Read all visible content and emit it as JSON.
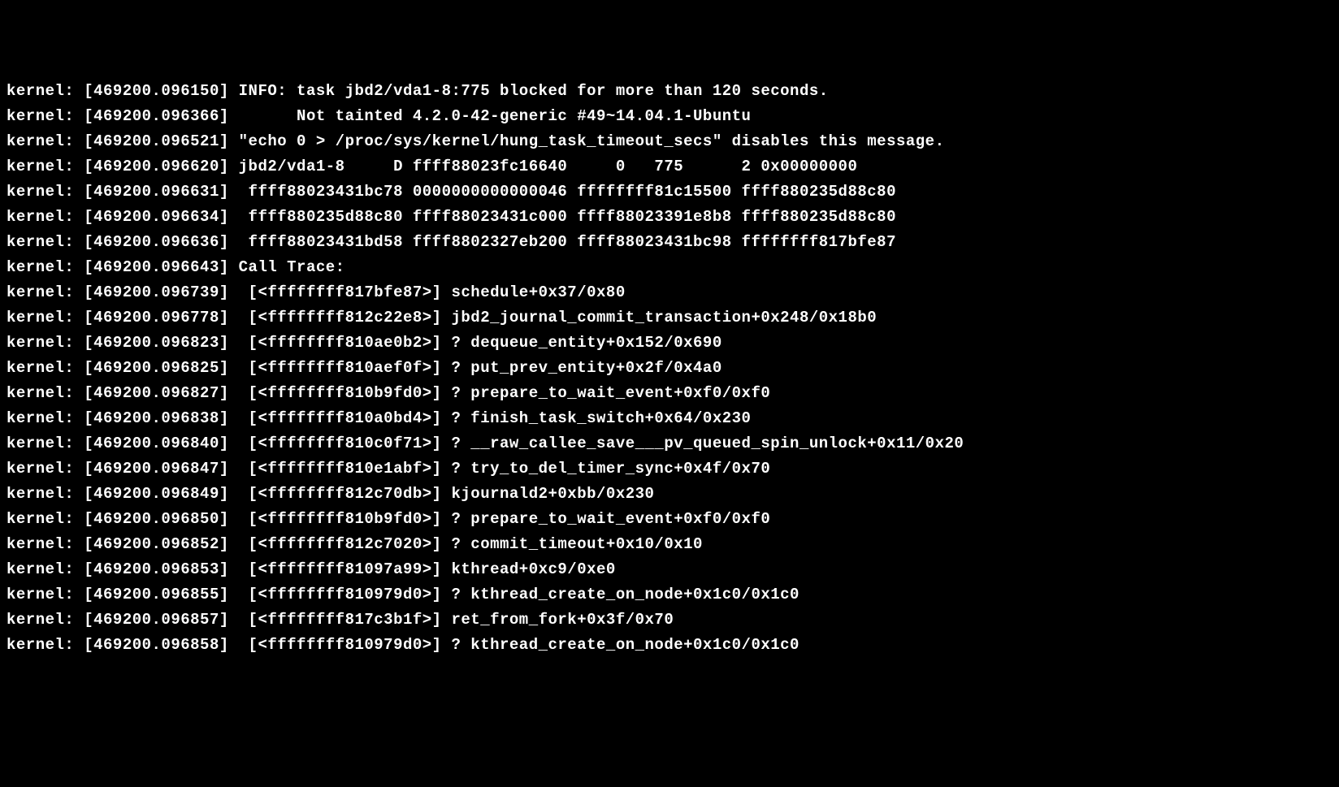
{
  "lines": [
    "kernel: [469200.096150] INFO: task jbd2/vda1-8:775 blocked for more than 120 seconds.",
    "kernel: [469200.096366]       Not tainted 4.2.0-42-generic #49~14.04.1-Ubuntu",
    "kernel: [469200.096521] \"echo 0 > /proc/sys/kernel/hung_task_timeout_secs\" disables this message.",
    "kernel: [469200.096620] jbd2/vda1-8     D ffff88023fc16640     0   775      2 0x00000000",
    "kernel: [469200.096631]  ffff88023431bc78 0000000000000046 ffffffff81c15500 ffff880235d88c80",
    "kernel: [469200.096634]  ffff880235d88c80 ffff88023431c000 ffff88023391e8b8 ffff880235d88c80",
    "kernel: [469200.096636]  ffff88023431bd58 ffff8802327eb200 ffff88023431bc98 ffffffff817bfe87",
    "kernel: [469200.096643] Call Trace:",
    "kernel: [469200.096739]  [<ffffffff817bfe87>] schedule+0x37/0x80",
    "kernel: [469200.096778]  [<ffffffff812c22e8>] jbd2_journal_commit_transaction+0x248/0x18b0",
    "kernel: [469200.096823]  [<ffffffff810ae0b2>] ? dequeue_entity+0x152/0x690",
    "kernel: [469200.096825]  [<ffffffff810aef0f>] ? put_prev_entity+0x2f/0x4a0",
    "kernel: [469200.096827]  [<ffffffff810b9fd0>] ? prepare_to_wait_event+0xf0/0xf0",
    "kernel: [469200.096838]  [<ffffffff810a0bd4>] ? finish_task_switch+0x64/0x230",
    "kernel: [469200.096840]  [<ffffffff810c0f71>] ? __raw_callee_save___pv_queued_spin_unlock+0x11/0x20",
    "kernel: [469200.096847]  [<ffffffff810e1abf>] ? try_to_del_timer_sync+0x4f/0x70",
    "kernel: [469200.096849]  [<ffffffff812c70db>] kjournald2+0xbb/0x230",
    "kernel: [469200.096850]  [<ffffffff810b9fd0>] ? prepare_to_wait_event+0xf0/0xf0",
    "kernel: [469200.096852]  [<ffffffff812c7020>] ? commit_timeout+0x10/0x10",
    "kernel: [469200.096853]  [<ffffffff81097a99>] kthread+0xc9/0xe0",
    "kernel: [469200.096855]  [<ffffffff810979d0>] ? kthread_create_on_node+0x1c0/0x1c0",
    "kernel: [469200.096857]  [<ffffffff817c3b1f>] ret_from_fork+0x3f/0x70",
    "kernel: [469200.096858]  [<ffffffff810979d0>] ? kthread_create_on_node+0x1c0/0x1c0"
  ]
}
